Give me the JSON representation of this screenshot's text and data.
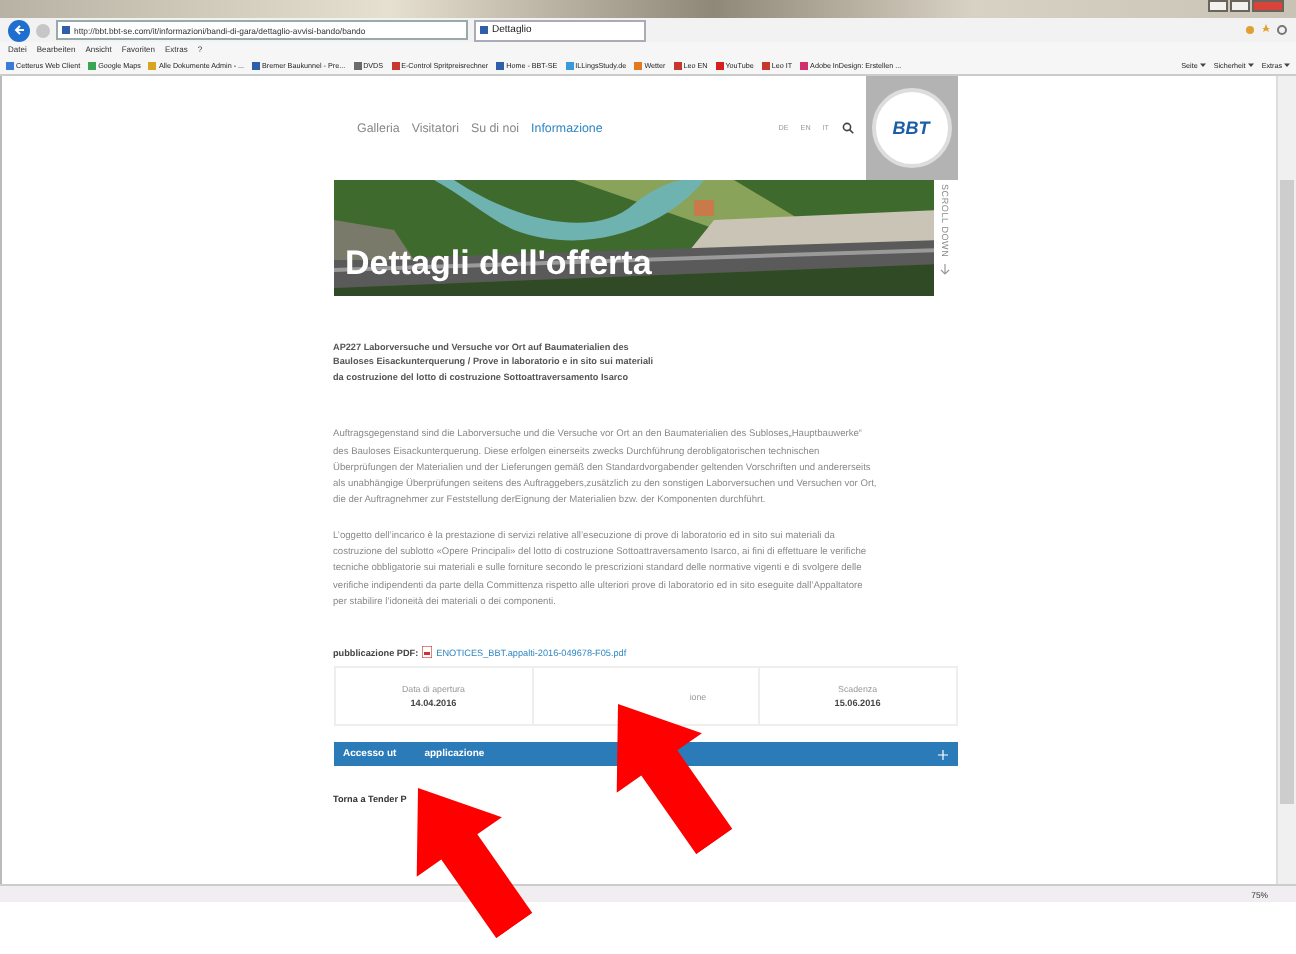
{
  "browser": {
    "url": "http://bbt.bbt-se.com/it/informazioni/bandi-di-gara/dettaglio-avvisi-bando/bando",
    "tab": "Dettaglio",
    "menu": [
      "Datei",
      "Bearbeiten",
      "Ansicht",
      "Favoriten",
      "Extras",
      "?"
    ],
    "favorites": [
      {
        "label": "Cetterus Web Client",
        "color": "#3a7bd5"
      },
      {
        "label": "Google Maps",
        "color": "#3aa655"
      },
      {
        "label": "Alle Dokumente Admin - ...",
        "color": "#d9a520"
      },
      {
        "label": "Bremer Baukunnel - Pre...",
        "color": "#2f5fa8"
      },
      {
        "label": "DVDS",
        "color": "#6b6b6b"
      },
      {
        "label": "E-Control Spritpreisrechner",
        "color": "#c8372d"
      },
      {
        "label": "Home - BBT-SE",
        "color": "#2f5fa8"
      },
      {
        "label": "ILLingsStudy.de",
        "color": "#3a9ad9"
      },
      {
        "label": "Wetter",
        "color": "#e07b1f"
      },
      {
        "label": "Leo EN",
        "color": "#c8372d"
      },
      {
        "label": "YouTube",
        "color": "#d62020"
      },
      {
        "label": "Leo IT",
        "color": "#c8372d"
      },
      {
        "label": "Adobe InDesign: Erstellen ...",
        "color": "#d0306e"
      }
    ],
    "commands": [
      "Seite",
      "Sicherheit",
      "Extras"
    ],
    "zoom": "75%"
  },
  "site": {
    "nav": [
      {
        "label": "Galleria",
        "selected": false
      },
      {
        "label": "Visitatori",
        "selected": false
      },
      {
        "label": "Su di noi",
        "selected": false
      },
      {
        "label": "Informazione",
        "selected": true
      }
    ],
    "languages": [
      "DE",
      "EN",
      "IT"
    ],
    "logo": "BBT",
    "hero_title": "Dettagli dell'offerta",
    "scroll_hint": "SCROLL DOWN",
    "tender_title": "AP227 Laborversuche und Versuche vor Ort auf Baumaterialien des Bauloses Eisackunterquerung / Prove in laboratorio e in sito sui materiali da costruzione del lotto di costruzione Sottoattraversamento Isarco",
    "paragraphs": [
      "Auftragsgegenstand sind die Laborversuche und die Versuche vor Ort an den Baumaterialien des Subloses„Hauptbauwerke“ des Bauloses Eisackunterquerung. Diese erfolgen einerseits zwecks Durchführung derobligatorischen technischen Überprüfungen der Materialien und der Lieferungen gemäß den Standardvorgabender geltenden Vorschriften und andererseits als unabhängige Überprüfungen seitens des Auftraggebers,zusätzlich zu den sonstigen Laborversuchen und Versuchen vor Ort, die der Auftragnehmer zur Feststellung derEignung der Materialien bzw. der Komponenten durchführt.",
      "L’oggetto dell’incarico è la prestazione di servizi relative all’esecuzione di prove di laboratorio ed in sito sui materiali da costruzione del sublotto «Opere Principali» del lotto di costruzione Sottoattraversamento Isarco, ai fini di effettuare le verifiche tecniche obbligatorie sui materiali e sulle forniture secondo le prescrizioni standard delle normative vigenti e di svolgere delle verifiche indipendenti da parte della Committenza rispetto alle ulteriori prove di laboratorio ed in sito eseguite dall’Appaltatore per stabilire l’idoneità dei materiali o dei componenti."
    ],
    "pdf": {
      "label": "pubblicazione PDF:",
      "file": "ENOTICES_BBT.appalti-2016-049678-F05.pdf"
    },
    "dates": [
      {
        "label": "Data di apertura",
        "value": "14.04.2016"
      },
      {
        "label": "ione"
      },
      {
        "label": "Scadenza",
        "value": "15.06.2016"
      }
    ],
    "accordion": {
      "title_start": "Accesso ut",
      "title_end": "applicazione",
      "expanded": false
    },
    "back_link": "Torna a Tender P"
  },
  "annotations": [
    {
      "kind": "arrow"
    },
    {
      "kind": "arrow"
    }
  ]
}
